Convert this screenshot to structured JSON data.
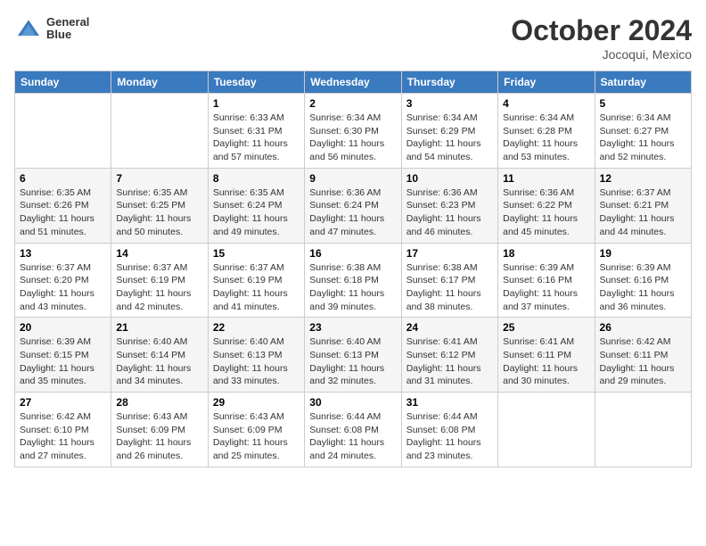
{
  "logo": {
    "line1": "General",
    "line2": "Blue"
  },
  "title": "October 2024",
  "location": "Jocoqui, Mexico",
  "days_of_week": [
    "Sunday",
    "Monday",
    "Tuesday",
    "Wednesday",
    "Thursday",
    "Friday",
    "Saturday"
  ],
  "weeks": [
    [
      null,
      null,
      {
        "day": 1,
        "sunrise": "6:33 AM",
        "sunset": "6:31 PM",
        "daylight": "11 hours and 57 minutes."
      },
      {
        "day": 2,
        "sunrise": "6:34 AM",
        "sunset": "6:30 PM",
        "daylight": "11 hours and 56 minutes."
      },
      {
        "day": 3,
        "sunrise": "6:34 AM",
        "sunset": "6:29 PM",
        "daylight": "11 hours and 54 minutes."
      },
      {
        "day": 4,
        "sunrise": "6:34 AM",
        "sunset": "6:28 PM",
        "daylight": "11 hours and 53 minutes."
      },
      {
        "day": 5,
        "sunrise": "6:34 AM",
        "sunset": "6:27 PM",
        "daylight": "11 hours and 52 minutes."
      }
    ],
    [
      {
        "day": 6,
        "sunrise": "6:35 AM",
        "sunset": "6:26 PM",
        "daylight": "11 hours and 51 minutes."
      },
      {
        "day": 7,
        "sunrise": "6:35 AM",
        "sunset": "6:25 PM",
        "daylight": "11 hours and 50 minutes."
      },
      {
        "day": 8,
        "sunrise": "6:35 AM",
        "sunset": "6:24 PM",
        "daylight": "11 hours and 49 minutes."
      },
      {
        "day": 9,
        "sunrise": "6:36 AM",
        "sunset": "6:24 PM",
        "daylight": "11 hours and 47 minutes."
      },
      {
        "day": 10,
        "sunrise": "6:36 AM",
        "sunset": "6:23 PM",
        "daylight": "11 hours and 46 minutes."
      },
      {
        "day": 11,
        "sunrise": "6:36 AM",
        "sunset": "6:22 PM",
        "daylight": "11 hours and 45 minutes."
      },
      {
        "day": 12,
        "sunrise": "6:37 AM",
        "sunset": "6:21 PM",
        "daylight": "11 hours and 44 minutes."
      }
    ],
    [
      {
        "day": 13,
        "sunrise": "6:37 AM",
        "sunset": "6:20 PM",
        "daylight": "11 hours and 43 minutes."
      },
      {
        "day": 14,
        "sunrise": "6:37 AM",
        "sunset": "6:19 PM",
        "daylight": "11 hours and 42 minutes."
      },
      {
        "day": 15,
        "sunrise": "6:37 AM",
        "sunset": "6:19 PM",
        "daylight": "11 hours and 41 minutes."
      },
      {
        "day": 16,
        "sunrise": "6:38 AM",
        "sunset": "6:18 PM",
        "daylight": "11 hours and 39 minutes."
      },
      {
        "day": 17,
        "sunrise": "6:38 AM",
        "sunset": "6:17 PM",
        "daylight": "11 hours and 38 minutes."
      },
      {
        "day": 18,
        "sunrise": "6:39 AM",
        "sunset": "6:16 PM",
        "daylight": "11 hours and 37 minutes."
      },
      {
        "day": 19,
        "sunrise": "6:39 AM",
        "sunset": "6:16 PM",
        "daylight": "11 hours and 36 minutes."
      }
    ],
    [
      {
        "day": 20,
        "sunrise": "6:39 AM",
        "sunset": "6:15 PM",
        "daylight": "11 hours and 35 minutes."
      },
      {
        "day": 21,
        "sunrise": "6:40 AM",
        "sunset": "6:14 PM",
        "daylight": "11 hours and 34 minutes."
      },
      {
        "day": 22,
        "sunrise": "6:40 AM",
        "sunset": "6:13 PM",
        "daylight": "11 hours and 33 minutes."
      },
      {
        "day": 23,
        "sunrise": "6:40 AM",
        "sunset": "6:13 PM",
        "daylight": "11 hours and 32 minutes."
      },
      {
        "day": 24,
        "sunrise": "6:41 AM",
        "sunset": "6:12 PM",
        "daylight": "11 hours and 31 minutes."
      },
      {
        "day": 25,
        "sunrise": "6:41 AM",
        "sunset": "6:11 PM",
        "daylight": "11 hours and 30 minutes."
      },
      {
        "day": 26,
        "sunrise": "6:42 AM",
        "sunset": "6:11 PM",
        "daylight": "11 hours and 29 minutes."
      }
    ],
    [
      {
        "day": 27,
        "sunrise": "6:42 AM",
        "sunset": "6:10 PM",
        "daylight": "11 hours and 27 minutes."
      },
      {
        "day": 28,
        "sunrise": "6:43 AM",
        "sunset": "6:09 PM",
        "daylight": "11 hours and 26 minutes."
      },
      {
        "day": 29,
        "sunrise": "6:43 AM",
        "sunset": "6:09 PM",
        "daylight": "11 hours and 25 minutes."
      },
      {
        "day": 30,
        "sunrise": "6:44 AM",
        "sunset": "6:08 PM",
        "daylight": "11 hours and 24 minutes."
      },
      {
        "day": 31,
        "sunrise": "6:44 AM",
        "sunset": "6:08 PM",
        "daylight": "11 hours and 23 minutes."
      },
      null,
      null
    ]
  ]
}
